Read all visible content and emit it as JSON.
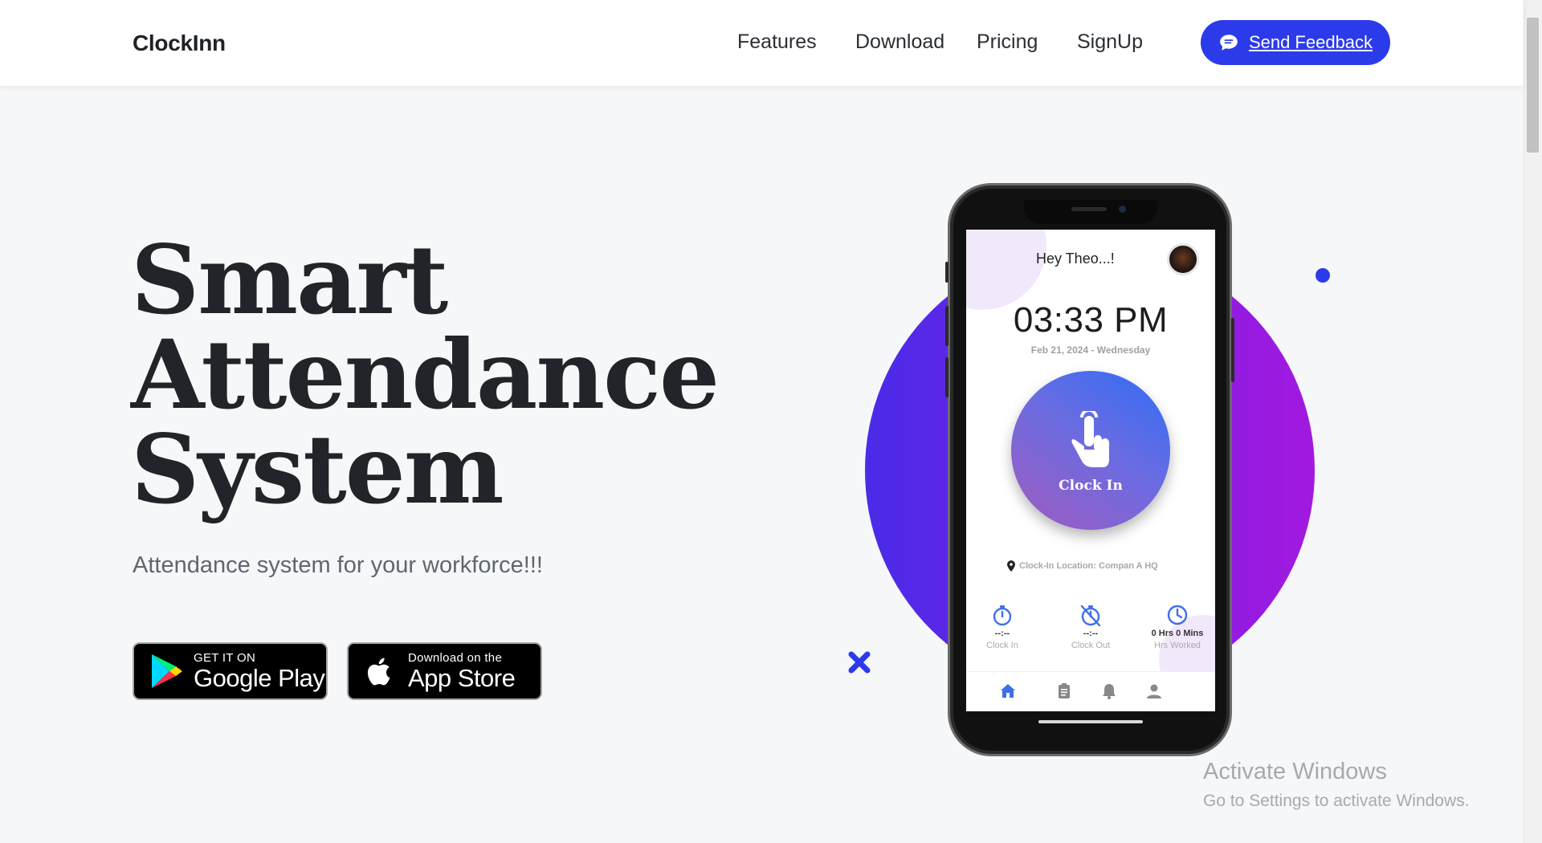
{
  "navbar": {
    "brand": "ClockInn",
    "links": [
      "Features",
      "Download",
      "Pricing",
      "SignUp"
    ],
    "feedback_label": "Send Feedback",
    "feedback_icon": "chat-bubble-icon"
  },
  "hero": {
    "title_lines": [
      "Smart",
      "Attendance",
      "System"
    ],
    "subtitle": "Attendance system for your workforce!!!"
  },
  "store_buttons": {
    "google_play": {
      "small": "GET IT ON",
      "big": "Google Play",
      "icon": "google-play-icon"
    },
    "app_store": {
      "small": "Download on the",
      "big": "App Store",
      "icon": "apple-icon"
    }
  },
  "phone": {
    "greeting": "Hey Theo...!",
    "time": "03:33 PM",
    "date": "Feb 21, 2024 - Wednesday",
    "clock_in_label": "Clock In",
    "location": "Clock-In Location: Compan A HQ",
    "stats": [
      {
        "value": "--:--",
        "caption": "Clock In",
        "icon": "stopwatch-icon"
      },
      {
        "value": "--:--",
        "caption": "Clock Out",
        "icon": "stopwatch-off-icon"
      },
      {
        "value": "0 Hrs 0 Mins",
        "caption": "Hrs Worked",
        "icon": "clock-icon"
      }
    ],
    "tabs": [
      "home-icon",
      "clipboard-icon",
      "bell-icon",
      "user-icon"
    ]
  },
  "watermark": {
    "title": "Activate Windows",
    "subtitle": "Go to Settings to activate Windows."
  },
  "colors": {
    "accent": "#2b3bea",
    "circle_start": "#4a2be8",
    "circle_end": "#a219df",
    "background": "#f6f7f9"
  }
}
